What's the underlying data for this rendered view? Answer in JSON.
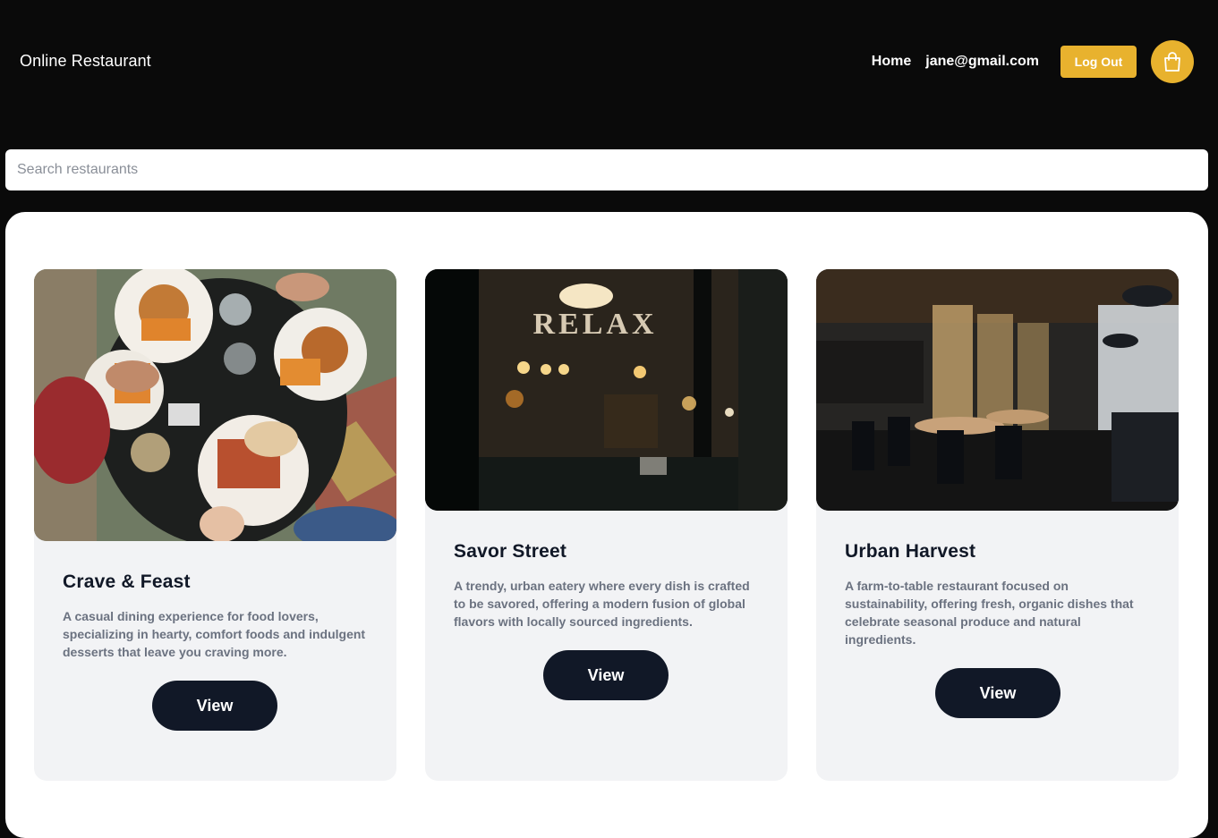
{
  "header": {
    "brand": "Online Restaurant",
    "nav": {
      "home": "Home",
      "email": "jane@gmail.com",
      "logout": "Log Out",
      "cart_icon": "shopping-bag-icon"
    }
  },
  "search": {
    "placeholder": "Search restaurants",
    "value": ""
  },
  "restaurants": [
    {
      "name": "Crave & Feast",
      "description": "A casual dining experience for food lovers, specializing in hearty, comfort foods and indulgent desserts that leave you craving more.",
      "button": "View",
      "image": "overhead-table-with-burgers-and-fries"
    },
    {
      "name": "Savor Street",
      "description": "A trendy, urban eatery where every dish is crafted to be savored, offering a modern fusion of global flavors with locally sourced ingredients.",
      "button": "View",
      "image": "restaurant-window-at-night-relax-sign",
      "image_sign": "RELAX"
    },
    {
      "name": "Urban Harvest",
      "description": "A farm-to-table restaurant focused on sustainability, offering fresh, organic dishes that celebrate seasonal produce and natural ingredients.",
      "button": "View",
      "image": "modern-restaurant-interior-dining-room"
    }
  ],
  "colors": {
    "background": "#0a0a0a",
    "accent": "#e8b22e",
    "button_dark": "#111827",
    "card_bg": "#f2f3f5"
  }
}
